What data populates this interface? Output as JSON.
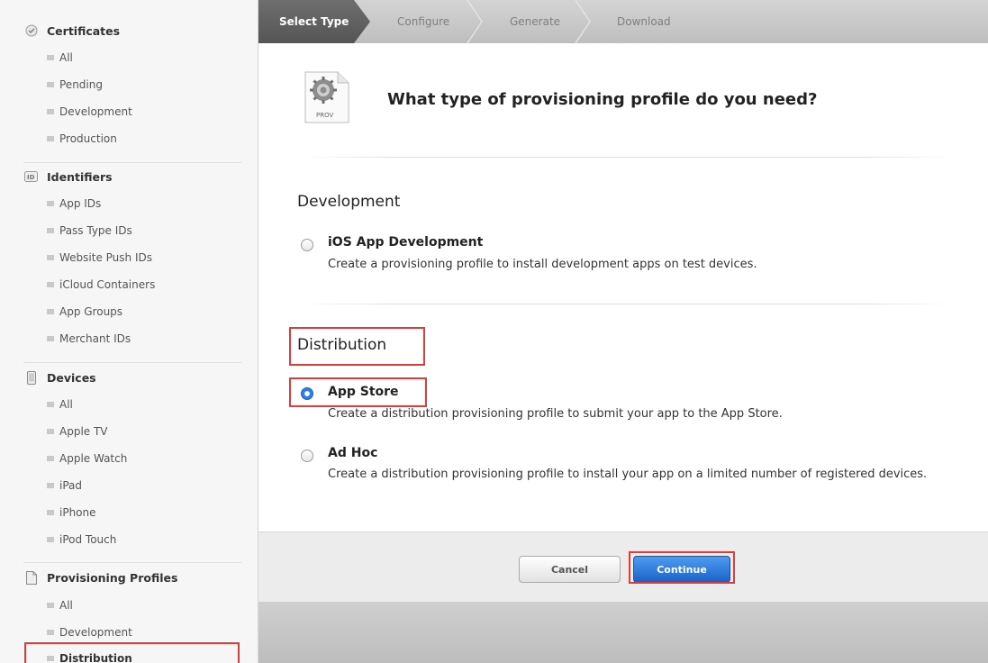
{
  "sidebar": {
    "certificates": {
      "heading": "Certificates",
      "icon": "certificate-icon",
      "items": [
        "All",
        "Pending",
        "Development",
        "Production"
      ]
    },
    "identifiers": {
      "heading": "Identifiers",
      "icon": "id-badge-icon",
      "items": [
        "App IDs",
        "Pass Type IDs",
        "Website Push IDs",
        "iCloud Containers",
        "App Groups",
        "Merchant IDs"
      ]
    },
    "devices": {
      "heading": "Devices",
      "icon": "device-icon",
      "items": [
        "All",
        "Apple TV",
        "Apple Watch",
        "iPad",
        "iPhone",
        "iPod Touch"
      ]
    },
    "provisioning": {
      "heading": "Provisioning Profiles",
      "icon": "document-icon",
      "items": [
        "All",
        "Development",
        "Distribution"
      ],
      "active": "Distribution"
    }
  },
  "steps": [
    "Select Type",
    "Configure",
    "Generate",
    "Download"
  ],
  "active_step": "Select Type",
  "main": {
    "icon_label": "PROV",
    "question": "What type of provisioning profile do you need?",
    "development": {
      "title": "Development",
      "options": [
        {
          "title": "iOS App Development",
          "desc": "Create a provisioning profile to install development apps on test devices.",
          "checked": false
        }
      ]
    },
    "distribution": {
      "title": "Distribution",
      "options": [
        {
          "title": "App Store",
          "desc": "Create a distribution provisioning profile to submit your app to the App Store.",
          "checked": true
        },
        {
          "title": "Ad Hoc",
          "desc": "Create a distribution provisioning profile to install your app on a limited number of registered devices.",
          "checked": false
        }
      ]
    }
  },
  "footer": {
    "cancel_label": "Cancel",
    "continue_label": "Continue"
  },
  "colors": {
    "accent": "#2f7fe6",
    "highlight": "#e03a3a"
  }
}
